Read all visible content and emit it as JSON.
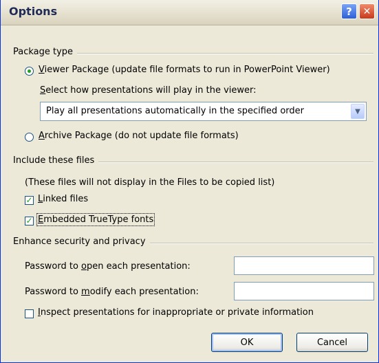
{
  "window": {
    "title": "Options"
  },
  "titlebar": {
    "help_label": "?",
    "close_label": "✕"
  },
  "package_type": {
    "heading": "Package type",
    "viewer_radio_prefix": "",
    "viewer_radio_accel": "V",
    "viewer_radio_rest": "iewer Package (update file formats to run in PowerPoint Viewer)",
    "select_label_accel": "S",
    "select_label_rest": "elect how presentations will play in the viewer:",
    "play_mode_value": "Play all presentations automatically in the specified order",
    "archive_radio_accel": "A",
    "archive_radio_rest": "rchive Package (do not update file formats)"
  },
  "include_files": {
    "heading": "Include these files",
    "note": "(These files will not display in the Files to be copied list)",
    "linked_accel": "L",
    "linked_rest": "inked files",
    "linked_checked": true,
    "embedded_accel": "E",
    "embedded_rest": "mbedded TrueType fonts",
    "embedded_checked": true
  },
  "security": {
    "heading": "Enhance security and privacy",
    "open_pw_prefix": "Password to ",
    "open_pw_accel": "o",
    "open_pw_rest": "pen each presentation:",
    "open_pw_value": "",
    "modify_pw_prefix": "Password to ",
    "modify_pw_accel": "m",
    "modify_pw_rest": "odify each presentation:",
    "modify_pw_value": "",
    "inspect_accel": "I",
    "inspect_rest": "nspect presentations for inappropriate or private information",
    "inspect_checked": false
  },
  "buttons": {
    "ok_label": "OK",
    "cancel_label": "Cancel"
  },
  "colors": {
    "titlebar_text": "#1f2a55",
    "check_mark": "#21a121",
    "face": "#ece9d8"
  }
}
